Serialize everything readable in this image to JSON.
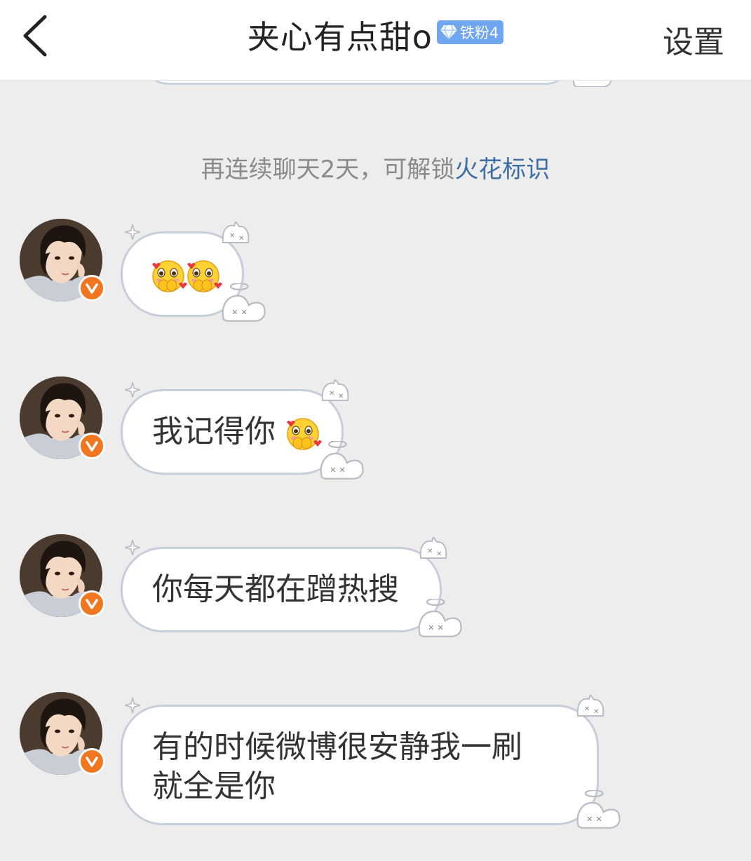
{
  "header": {
    "title": "夹心有点甜o",
    "fan_badge_label": "铁粉4",
    "settings_label": "设置",
    "badge_color": "#6fa6ef"
  },
  "system_message": {
    "text": "再连续聊天2天，可解锁",
    "link_text": "火花标识"
  },
  "messages": [
    {
      "text": "",
      "emoji": [
        "shy-face-emoji",
        "shy-face-emoji"
      ]
    },
    {
      "text": "我记得你",
      "emoji": [
        "shy-face-emoji"
      ]
    },
    {
      "text": "你每天都在蹭热搜",
      "emoji": []
    },
    {
      "text": "有的时候微博很安静我一刷",
      "text2": "就全是你",
      "emoji": []
    }
  ],
  "colors": {
    "background": "#ededed",
    "bubble_border": "#c7cedb",
    "verified_badge": "#f0761f",
    "link": "#3e6ea3"
  }
}
